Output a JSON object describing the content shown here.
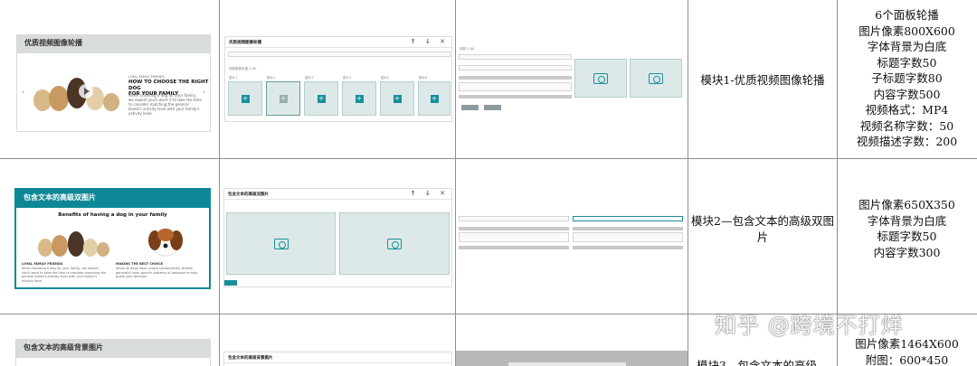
{
  "rows": [
    {
      "preview": {
        "header": "优质视频图像轮播",
        "small_tag": "LOYAL FAMILY FRIENDS",
        "heading_line1": "HOW TO CHOOSE THE RIGHT DOG",
        "heading_line2": "FOR YOUR FAMILY",
        "body": "When choosing a dog for your family, we expect you'll want it to take the time to consider matching the general breed's activity level with your family's activity level."
      },
      "admin": {
        "title": "优质视频图像轮播",
        "controls": "↑ ↓ ✕",
        "tile_labels": [
          "图片1",
          "图片2",
          "图片3",
          "图片4",
          "图片5",
          "图片6"
        ],
        "section_label": "视频图像轮播 (1/6)"
      },
      "editor": {
        "top_label": "视频 (1/6)"
      },
      "module": "模块1-优质视频图像轮播",
      "spec_lines": [
        "6个面板轮播",
        "图片像素800X600",
        "字体背景为白底",
        "标题字数50",
        "子标题字数80",
        "内容字数500",
        "视频格式：MP4",
        "视频名称字数：50",
        "视频描述字数：200"
      ]
    },
    {
      "preview": {
        "header": "包含文本的高级双图片",
        "subheading": "Benefits of having a dog in your family",
        "left_tag": "LOYAL FAMILY FRIENDS",
        "left_body": "When choosing a dog for your family, we expect you'll want to take the time to consider matching the general breed's activity level with your family's activity level.",
        "right_tag": "MAKING THE BEST CHOICE",
        "right_body": "While all dogs have unique personalities, breeds generally have specific patterns of behavior to help guide your decision."
      },
      "admin": {
        "title": "包含文本的高级双图片",
        "controls": "↑ ↓ ✕"
      },
      "module": "模块2—包含文本的高级双图片",
      "spec_lines": [
        "图片像素650X350",
        "字体背景为白底",
        "标题字数50",
        "内容字数300"
      ]
    },
    {
      "preview": {
        "header": "包含文本的高级背景图片"
      },
      "admin": {
        "title": "包含文本的高级背景图片"
      },
      "module": "模块3—包含文本的高级",
      "spec_lines": [
        "图片像素1464X600",
        "附图：600*450"
      ]
    }
  ],
  "watermark": "知乎 @跨境不打烊"
}
